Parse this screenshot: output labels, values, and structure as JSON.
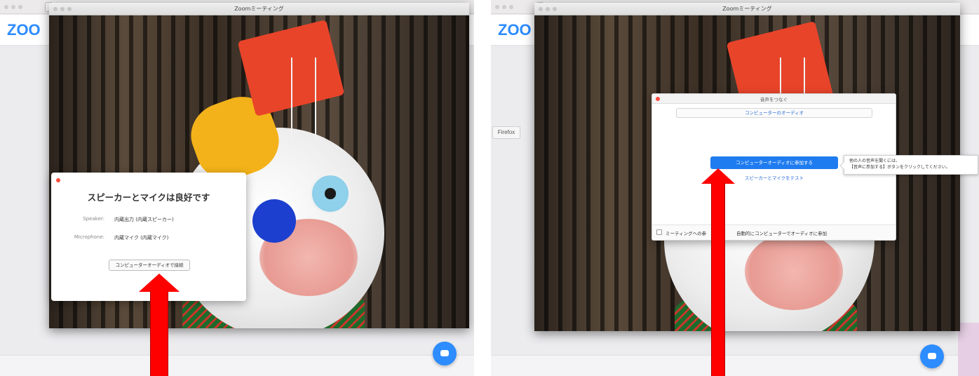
{
  "left": {
    "meeting_window_title": "Zoomミーティング",
    "logo_text": "ZOO",
    "dialog": {
      "heading": "スピーカーとマイクは良好です",
      "speaker_label": "Speaker:",
      "speaker_value": "内蔵出力 (内蔵スピーカー)",
      "microphone_label": "Microphone:",
      "microphone_value": "内蔵マイク (内蔵マイク)",
      "connect_button": "コンピューターオーディオで接続"
    }
  },
  "right": {
    "meeting_window_title": "Zoomミーティング",
    "logo_text": "ZOO",
    "firefox_label": "Firefox",
    "dialog": {
      "title": "音声をつなぐ",
      "tab_computer_audio": "コンピューターのオーディオ",
      "join_button": "コンピューターオーディオに参加する",
      "test_link": "スピーカーとマイクをテスト",
      "checkbox_label": "ミーティングへの参",
      "checkbox_label_tail": "自動的にコンピューターでオーディオに参加",
      "tooltip_line1": "他の人の音声を聞くには、",
      "tooltip_line2": "【音声に参加する】ボタンをクリックしてください。"
    }
  },
  "colors": {
    "zoom_blue": "#2d8cff",
    "join_button_blue": "#1f7cf0",
    "arrow_red": "#ff0000"
  },
  "icons": [
    "chat-icon",
    "back-arrow-icon",
    "window-close-dot-icon",
    "red-pointer-arrow"
  ]
}
